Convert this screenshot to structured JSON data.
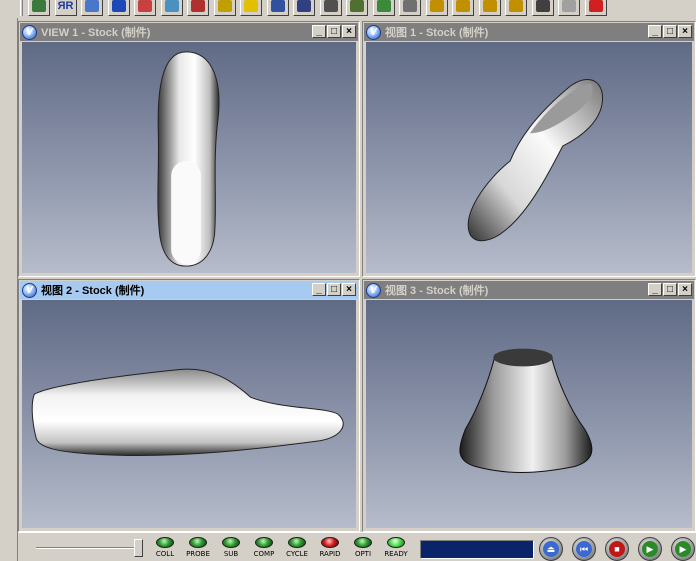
{
  "toolbar": {
    "icons": [
      {
        "name": "open-icon",
        "color": "#3a7a3a"
      },
      {
        "name": "select-icon",
        "color": "#1c3d9c",
        "label": "ЯR"
      },
      {
        "name": "home-icon",
        "color": "#4a78c8"
      },
      {
        "name": "info-icon",
        "color": "#1c48b8"
      },
      {
        "name": "draw-icon",
        "color": "#c84040"
      },
      {
        "name": "surface-icon",
        "color": "#4a90c0"
      },
      {
        "name": "tool-icon",
        "color": "#b03030"
      },
      {
        "name": "cube-icon",
        "color": "#c0a000"
      },
      {
        "name": "probe-icon",
        "color": "#e0c000"
      },
      {
        "name": "book-icon",
        "color": "#3050a0"
      },
      {
        "name": "toolpath-icon",
        "color": "#304080"
      },
      {
        "name": "layers-icon",
        "color": "#505050"
      },
      {
        "name": "view-icon",
        "color": "#507030"
      },
      {
        "name": "level-icon",
        "color": "#3a8a3a"
      },
      {
        "name": "print-icon",
        "color": "#707070"
      },
      {
        "name": "rotate-left-icon",
        "color": "#c09000"
      },
      {
        "name": "rotate-right-icon",
        "color": "#c09000"
      },
      {
        "name": "refresh-icon",
        "color": "#c09000"
      },
      {
        "name": "zoom-icon",
        "color": "#c09000"
      },
      {
        "name": "pan-icon",
        "color": "#404040"
      },
      {
        "name": "fit-icon",
        "color": "#a0a0a0"
      },
      {
        "name": "close-icon",
        "color": "#d02020"
      }
    ]
  },
  "viewports": [
    {
      "title": "VIEW 1 - Stock (制件)",
      "active": false
    },
    {
      "title": "视图 1 - Stock (制件)",
      "active": false
    },
    {
      "title": "视图 2 - Stock (制件)",
      "active": true
    },
    {
      "title": "视图 3 - Stock (制件)",
      "active": false
    }
  ],
  "window_controls": {
    "minimize": "_",
    "maximize": "□",
    "close": "×"
  },
  "status": {
    "indicators": [
      {
        "label": "COLL",
        "state": "green"
      },
      {
        "label": "PROBE",
        "state": "green"
      },
      {
        "label": "SUB",
        "state": "green"
      },
      {
        "label": "COMP",
        "state": "green"
      },
      {
        "label": "CYCLE",
        "state": "green"
      },
      {
        "label": "RAPID",
        "state": "red"
      },
      {
        "label": "OPTI",
        "state": "green"
      },
      {
        "label": "READY",
        "state": "bright"
      }
    ],
    "progress_color": "#0a246a",
    "buttons": [
      {
        "name": "eject-button",
        "glyph": "⏏",
        "color": "#3a6ad0"
      },
      {
        "name": "rewind-button",
        "glyph": "⏮",
        "color": "#3a6ad0"
      },
      {
        "name": "stop-button",
        "glyph": "■",
        "color": "#c01818"
      },
      {
        "name": "step-button",
        "glyph": "▶",
        "color": "#2a8a2a"
      },
      {
        "name": "play-button",
        "glyph": "▶",
        "color": "#2a8a2a"
      }
    ]
  }
}
